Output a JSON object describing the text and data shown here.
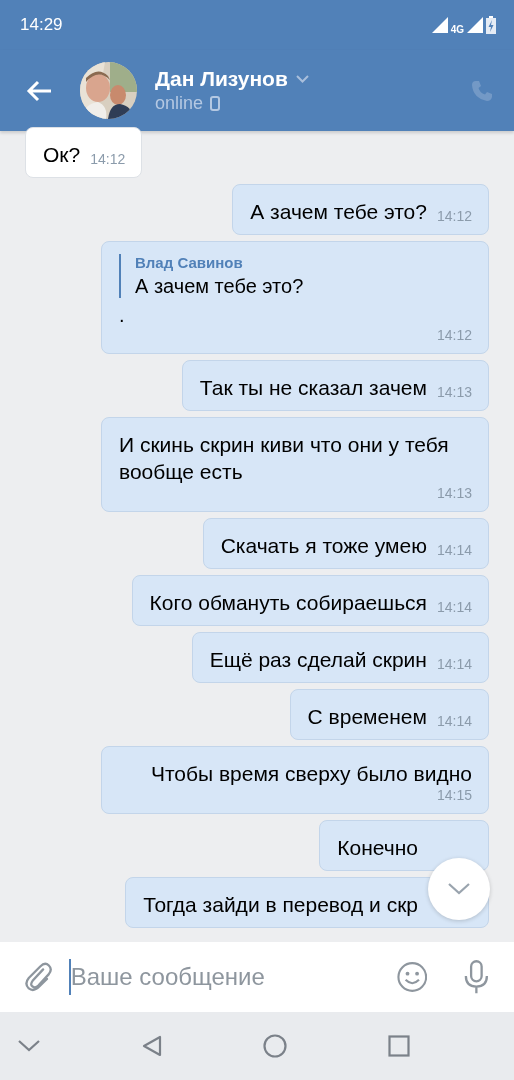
{
  "status_bar": {
    "time": "14:29",
    "network": "4G"
  },
  "header": {
    "name": "Дан Лизунов",
    "status": "online"
  },
  "messages": [
    {
      "kind": "incoming",
      "text": "Ок?",
      "time": "14:12"
    },
    {
      "kind": "outgoing",
      "text": "А зачем тебе это?",
      "time": "14:12"
    },
    {
      "kind": "reply",
      "author": "Влад Савинов",
      "quote": "А зачем тебе это?",
      "text": ".",
      "time": "14:12"
    },
    {
      "kind": "outgoing",
      "text": "Так ты не сказал зачем",
      "time": "14:13"
    },
    {
      "kind": "outgoing",
      "text": "И скинь скрин киви что они у тебя вообще есть",
      "time": "14:13"
    },
    {
      "kind": "outgoing",
      "text": "Скачать я тоже умею",
      "time": "14:14"
    },
    {
      "kind": "outgoing",
      "text": "Кого обмануть собираешься",
      "time": "14:14"
    },
    {
      "kind": "outgoing",
      "text": "Ещё раз сделай скрин",
      "time": "14:14"
    },
    {
      "kind": "outgoing",
      "text": "С временем",
      "time": "14:14"
    },
    {
      "kind": "outgoing",
      "text": "Чтобы время сверху было видно",
      "time": "14:15"
    },
    {
      "kind": "outgoing",
      "text": "Конечно"
    },
    {
      "kind": "outgoing",
      "text": "Тогда зайди в перевод и скр"
    }
  ],
  "composer": {
    "placeholder": "Ваше сообщение"
  }
}
